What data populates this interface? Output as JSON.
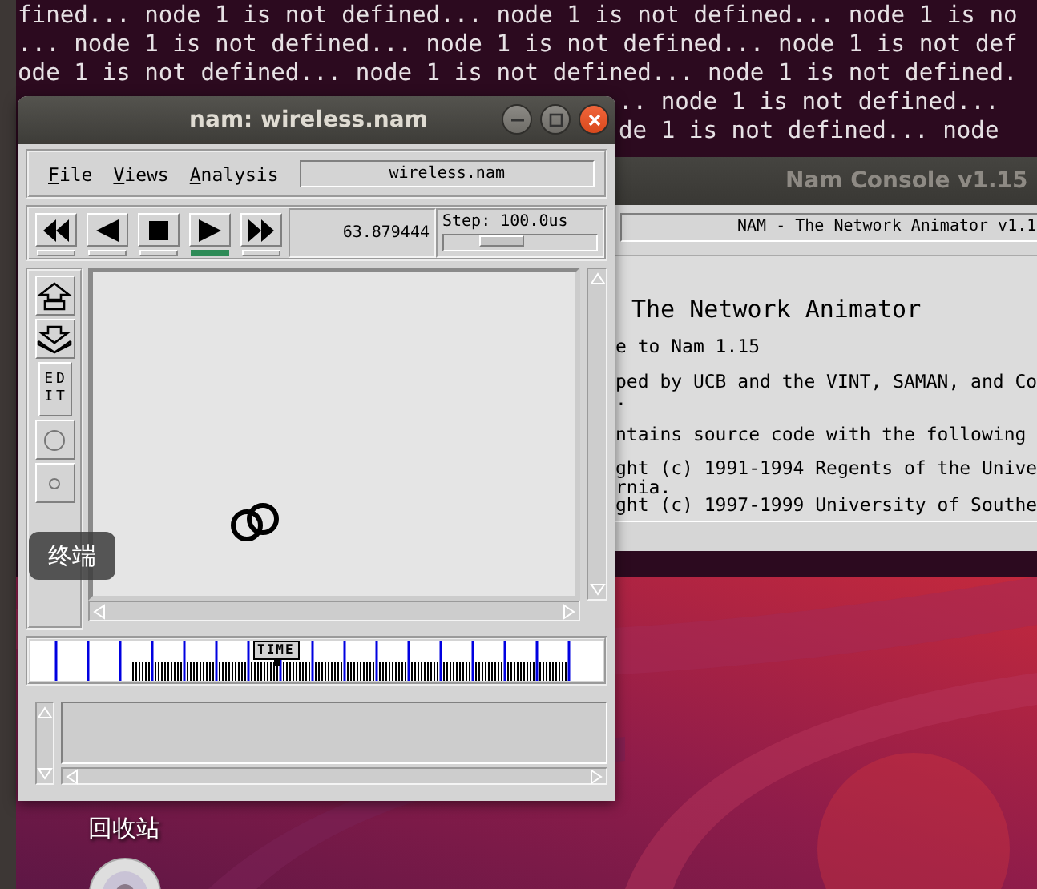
{
  "terminal": {
    "lines": [
      "fined... node 1 is not defined... node 1 is not defined... node 1 is no",
      "... node 1 is not defined... node 1 is not defined... node 1 is not def",
      "ode 1 is not defined... node 1 is not defined... node 1 is not defined."
    ],
    "partial_lines": [
      ".. node 1 is not defined...",
      "de 1 is not defined... node"
    ]
  },
  "nam_window": {
    "title": "nam: wireless.nam",
    "active": true,
    "menus": [
      {
        "label": "File"
      },
      {
        "label": "Views"
      },
      {
        "label": "Analysis"
      }
    ],
    "file_field": "wireless.nam",
    "transport": [
      {
        "kind": "rewind",
        "selected": false
      },
      {
        "kind": "back",
        "selected": false
      },
      {
        "kind": "stop",
        "selected": false
      },
      {
        "kind": "play",
        "selected": true
      },
      {
        "kind": "fast_forward",
        "selected": false
      }
    ],
    "time": "63.879444",
    "step": {
      "label": "Step: 100.0us",
      "level": 0.38
    },
    "tools": [
      {
        "kind": "zoom_in"
      },
      {
        "kind": "zoom_out"
      },
      {
        "kind": "edit",
        "label": "EDIT"
      },
      {
        "kind": "node"
      },
      {
        "kind": "small_node"
      }
    ],
    "timeline": {
      "marker": "TIME",
      "level": 0.43
    }
  },
  "tooltip": "终端",
  "console_window": {
    "title": "Nam Console v1.15",
    "active": false,
    "header": "NAM - The Network Animator v1.1",
    "lines": [
      {
        "kind": "heading",
        "text": "The Network Animator"
      },
      {
        "kind": "para",
        "text": "e to Nam 1.15"
      },
      {
        "kind": "para",
        "text": "ped by UCB and the VINT, SAMAN, and Co"
      },
      {
        "kind": "cont",
        "text": "."
      },
      {
        "kind": "para",
        "text": "ntains source code with the following"
      },
      {
        "kind": "para",
        "text": "ght (c) 1991-1994 Regents of the Unive"
      },
      {
        "kind": "cont",
        "text": "rnia."
      },
      {
        "kind": "cont",
        "text": "ght (c) 1997-1999 University of Southe"
      }
    ]
  },
  "desktop": {
    "trash_label": "回收站"
  }
}
